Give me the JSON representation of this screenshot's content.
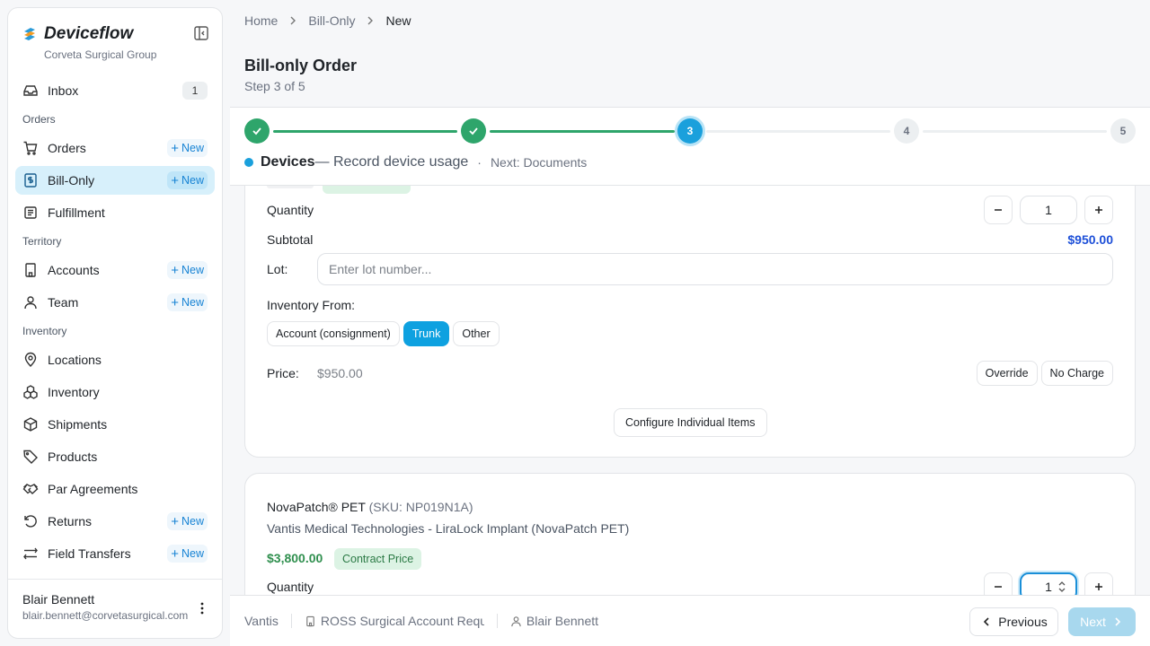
{
  "brand": {
    "name": "Deviceflow",
    "org": "Corveta Surgical Group"
  },
  "sidebar": {
    "inbox": {
      "label": "Inbox",
      "count": "1"
    },
    "sections": {
      "orders": "Orders",
      "territory": "Territory",
      "inventory": "Inventory"
    },
    "items": {
      "orders": {
        "label": "Orders",
        "new": "New"
      },
      "bill_only": {
        "label": "Bill-Only",
        "new": "New"
      },
      "fulfillment": {
        "label": "Fulfillment"
      },
      "accounts": {
        "label": "Accounts",
        "new": "New"
      },
      "team": {
        "label": "Team",
        "new": "New"
      },
      "locations": {
        "label": "Locations"
      },
      "inventory": {
        "label": "Inventory"
      },
      "shipments": {
        "label": "Shipments"
      },
      "products": {
        "label": "Products"
      },
      "par_agreements": {
        "label": "Par Agreements"
      },
      "returns": {
        "label": "Returns",
        "new": "New"
      },
      "field_transfers": {
        "label": "Field Transfers",
        "new": "New"
      }
    },
    "user": {
      "name": "Blair Bennett",
      "email": "blair.bennett@corvetasurgical.com"
    }
  },
  "breadcrumb": {
    "home": "Home",
    "section": "Bill-Only",
    "current": "New"
  },
  "page": {
    "title": "Bill-only Order",
    "step": "Step 3 of 5"
  },
  "stepper": {
    "steps": [
      "1",
      "2",
      "3",
      "4",
      "5"
    ],
    "current_index": 2,
    "current_name": "Devices",
    "current_desc": "— Record device usage",
    "separator": "·",
    "next": "Next: Documents"
  },
  "item1": {
    "quantity_label": "Quantity",
    "quantity": "1",
    "subtotal_label": "Subtotal",
    "subtotal": "$950.00",
    "lot_label": "Lot:",
    "lot_placeholder": "Enter lot number...",
    "inventory_label": "Inventory From:",
    "sources": [
      "Account (consignment)",
      "Trunk",
      "Other"
    ],
    "selected_source": "Trunk",
    "price_label": "Price:",
    "price": "$950.00",
    "override": "Override",
    "no_charge": "No Charge",
    "configure": "Configure Individual Items"
  },
  "item2": {
    "name": "NovaPatch® PET",
    "sku": "(SKU: NP019N1A)",
    "vendor": "Vantis Medical Technologies - LiraLock Implant (NovaPatch PET)",
    "price": "$3,800.00",
    "badge": "Contract Price",
    "quantity_label": "Quantity",
    "quantity": "1"
  },
  "footer": {
    "vendor": "Vantis",
    "account": "ROSS Surgical Account Request",
    "rep": "Blair Bennett",
    "previous": "Previous",
    "next": "Next"
  },
  "colors": {
    "accent": "#1aa0dc",
    "success": "#2ea56b",
    "active_nav_bg": "#d7f0fb",
    "subtotal": "#1d4fd8"
  }
}
